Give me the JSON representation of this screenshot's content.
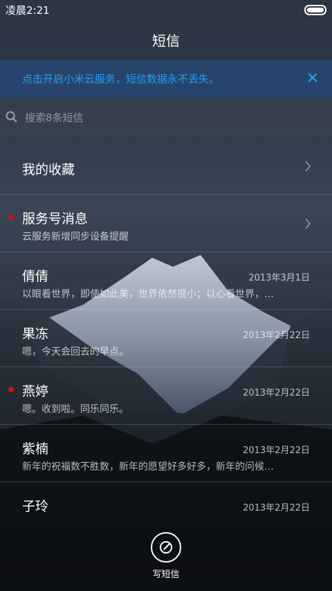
{
  "status": {
    "time": "凌晨2:21"
  },
  "header": {
    "title": "短信"
  },
  "banner": {
    "text": "点击开启小米云服务，短信数据永不丢失。"
  },
  "search": {
    "placeholder": "搜索8条短信"
  },
  "items": [
    {
      "name": "我的收藏",
      "snippet": "",
      "date": "",
      "unread": false,
      "chevron": true
    },
    {
      "name": "服务号消息",
      "snippet": "云服务新增同步设备提醒",
      "date": "",
      "unread": true,
      "chevron": true
    },
    {
      "name": "倩倩",
      "snippet": "以眼看世界，即使如此美，世界依然很小；以心看世界，…",
      "date": "2013年3月1日",
      "unread": false
    },
    {
      "name": "果冻",
      "snippet": "嗯，今天会回去的早点。",
      "date": "2013年2月22日",
      "unread": false
    },
    {
      "name": "燕婷",
      "snippet": "嗯。收到啦。同乐同乐。",
      "date": "2013年2月22日",
      "unread": true
    },
    {
      "name": "紫楠",
      "snippet": "新年的祝福数不胜数，新年的愿望好多好多，新年的问候…",
      "date": "2013年2月22日",
      "unread": false
    },
    {
      "name": "子玲",
      "snippet": "",
      "date": "2013年2月22日",
      "unread": false
    }
  ],
  "compose": {
    "label": "写短信"
  }
}
